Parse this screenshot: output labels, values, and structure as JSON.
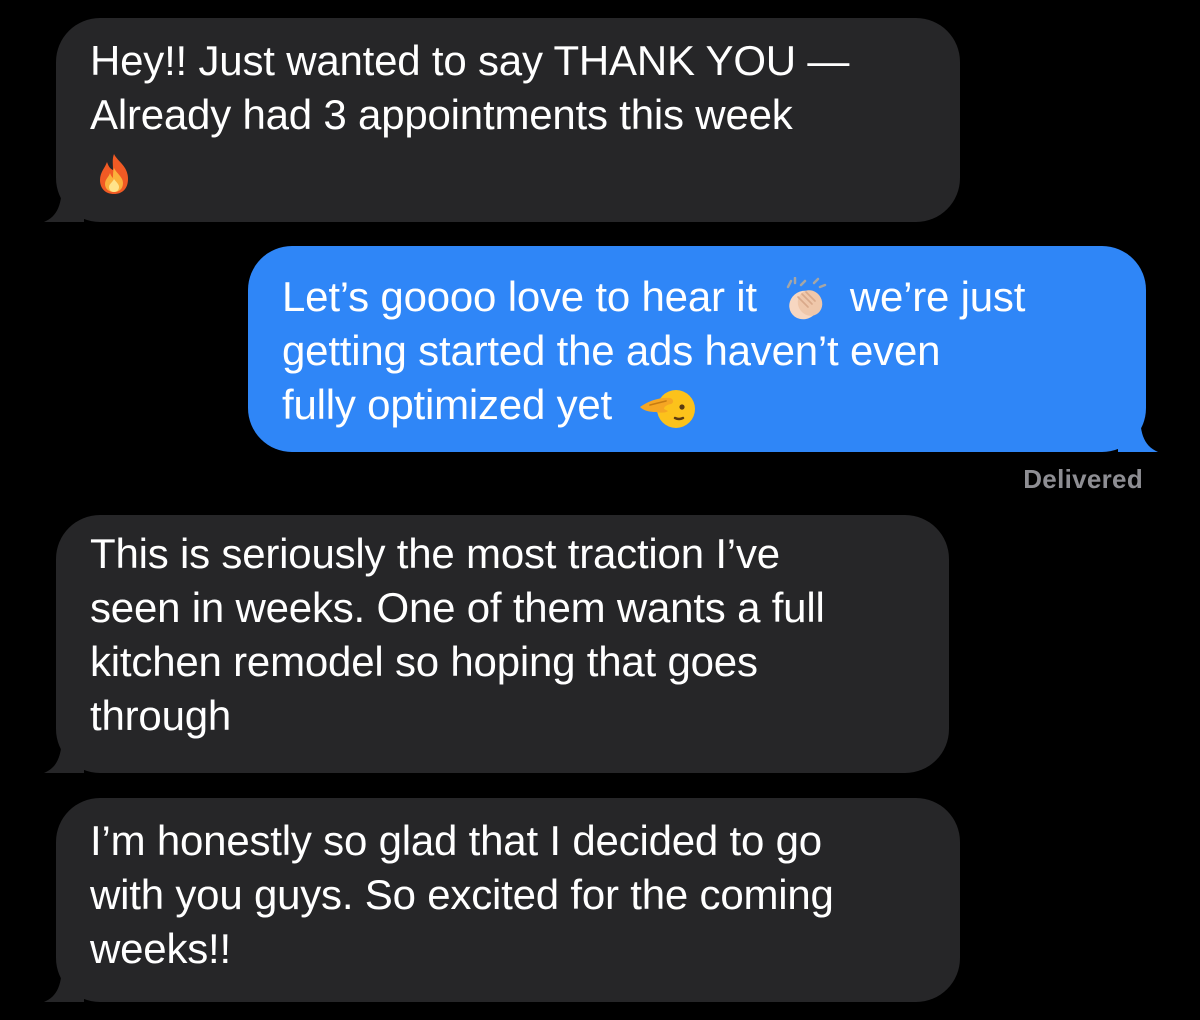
{
  "conversation": {
    "messages": [
      {
        "direction": "incoming",
        "lines": [
          "Hey!! Just wanted to say THANK YOU —",
          "Already had 3 appointments this week"
        ],
        "emojis": [
          "fire-icon"
        ]
      },
      {
        "direction": "outgoing",
        "line1_a": "Let’s goooo love to hear it",
        "line1_b": "we’re just",
        "line2": "getting started the ads haven’t even",
        "line3": "fully optimized yet",
        "emojis": [
          "clapping-hands-icon",
          "saluting-face-icon"
        ]
      },
      {
        "direction": "incoming",
        "lines": [
          "This is seriously the most traction I’ve",
          "seen in weeks. One of them wants a full",
          "kitchen remodel so hoping that goes",
          "through"
        ]
      },
      {
        "direction": "incoming",
        "lines": [
          "I’m honestly so glad that I decided to go",
          "with you guys. So excited for the coming",
          "weeks!!"
        ]
      }
    ],
    "delivery_status": "Delivered"
  },
  "colors": {
    "background": "#000000",
    "incoming_bubble": "#262628",
    "outgoing_bubble": "#2f86f7",
    "text": "#ffffff",
    "status_text": "#8e8e93"
  }
}
